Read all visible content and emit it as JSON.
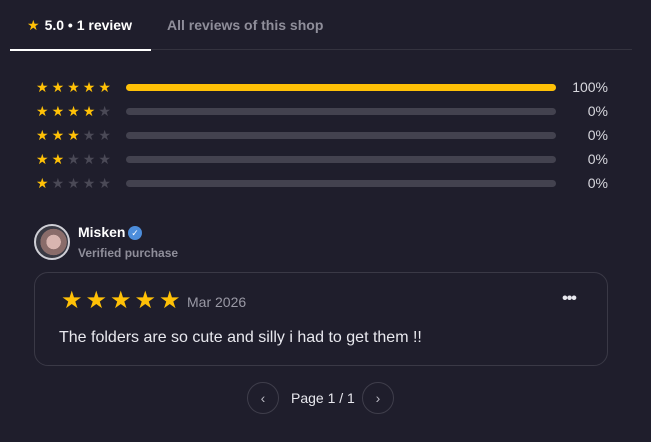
{
  "tabs": {
    "active_label": "5.0 • 1 review",
    "inactive_label": "All reviews of this shop"
  },
  "distribution": [
    {
      "stars": 5,
      "fill": 1.0,
      "percent_label": "100%"
    },
    {
      "stars": 4,
      "fill": 0.0,
      "percent_label": "0%"
    },
    {
      "stars": 3,
      "fill": 0.0,
      "percent_label": "0%"
    },
    {
      "stars": 2,
      "fill": 0.0,
      "percent_label": "0%"
    },
    {
      "stars": 1,
      "fill": 0.0,
      "percent_label": "0%"
    }
  ],
  "reviewer": {
    "name": "Misken",
    "verified_label": "Verified purchase",
    "badge_icon": "verified-check-icon"
  },
  "review": {
    "rating": 5,
    "date": "Mar 2026",
    "text": "The folders are so cute and silly i had to get them !!",
    "more_icon": "more-dots-icon"
  },
  "pagination": {
    "label": "Page 1 / 1",
    "prev_icon": "chevron-left-icon",
    "next_icon": "chevron-right-icon"
  },
  "colors": {
    "background": "#1f1e2c",
    "star": "#ffc107",
    "bar_track": "#43424f",
    "muted_text": "#8f8e9a"
  }
}
